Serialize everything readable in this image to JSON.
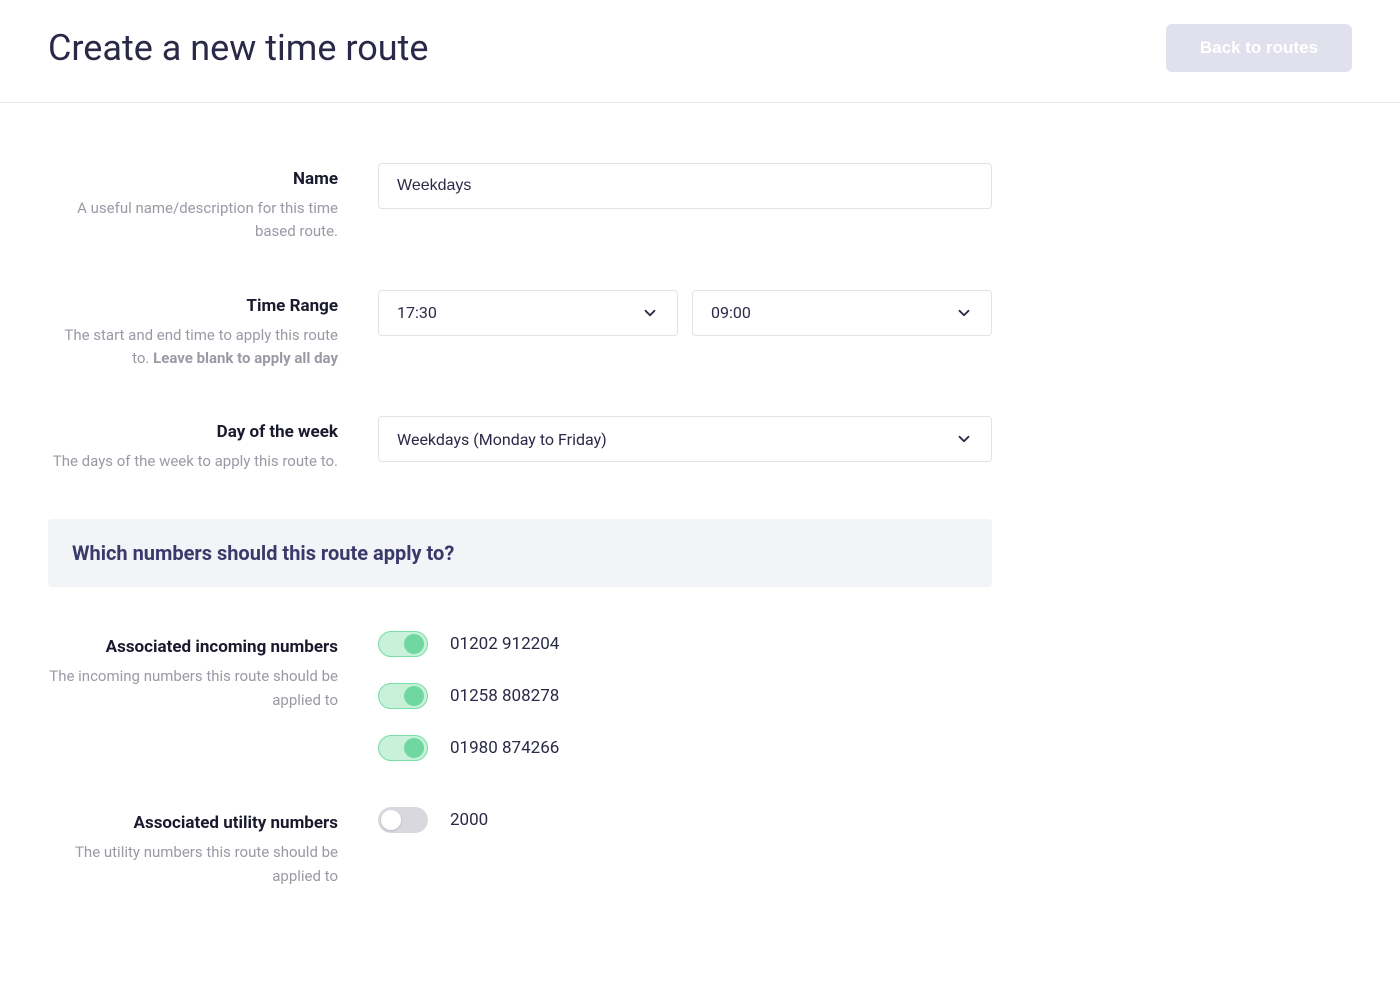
{
  "header": {
    "title": "Create a new time route",
    "back_label": "Back to routes"
  },
  "fields": {
    "name": {
      "label": "Name",
      "desc": "A useful name/description for this time based route.",
      "value": "Weekdays"
    },
    "time_range": {
      "label": "Time Range",
      "desc_pre": "The start and end time to apply this route to. ",
      "desc_strong": "Leave blank to apply all day",
      "start": "17:30",
      "end": "09:00"
    },
    "day_of_week": {
      "label": "Day of the week",
      "desc": "The days of the week to apply this route to.",
      "value": "Weekdays (Monday to Friday)"
    }
  },
  "section": {
    "title": "Which numbers should this route apply to?"
  },
  "incoming": {
    "label": "Associated incoming numbers",
    "desc": "The incoming numbers this route should be applied to",
    "items": [
      {
        "number": "01202 912204",
        "enabled": true
      },
      {
        "number": "01258 808278",
        "enabled": true
      },
      {
        "number": "01980 874266",
        "enabled": true
      }
    ]
  },
  "utility": {
    "label": "Associated utility numbers",
    "desc": "The utility numbers this route should be applied to",
    "items": [
      {
        "number": "2000",
        "enabled": false
      }
    ]
  }
}
